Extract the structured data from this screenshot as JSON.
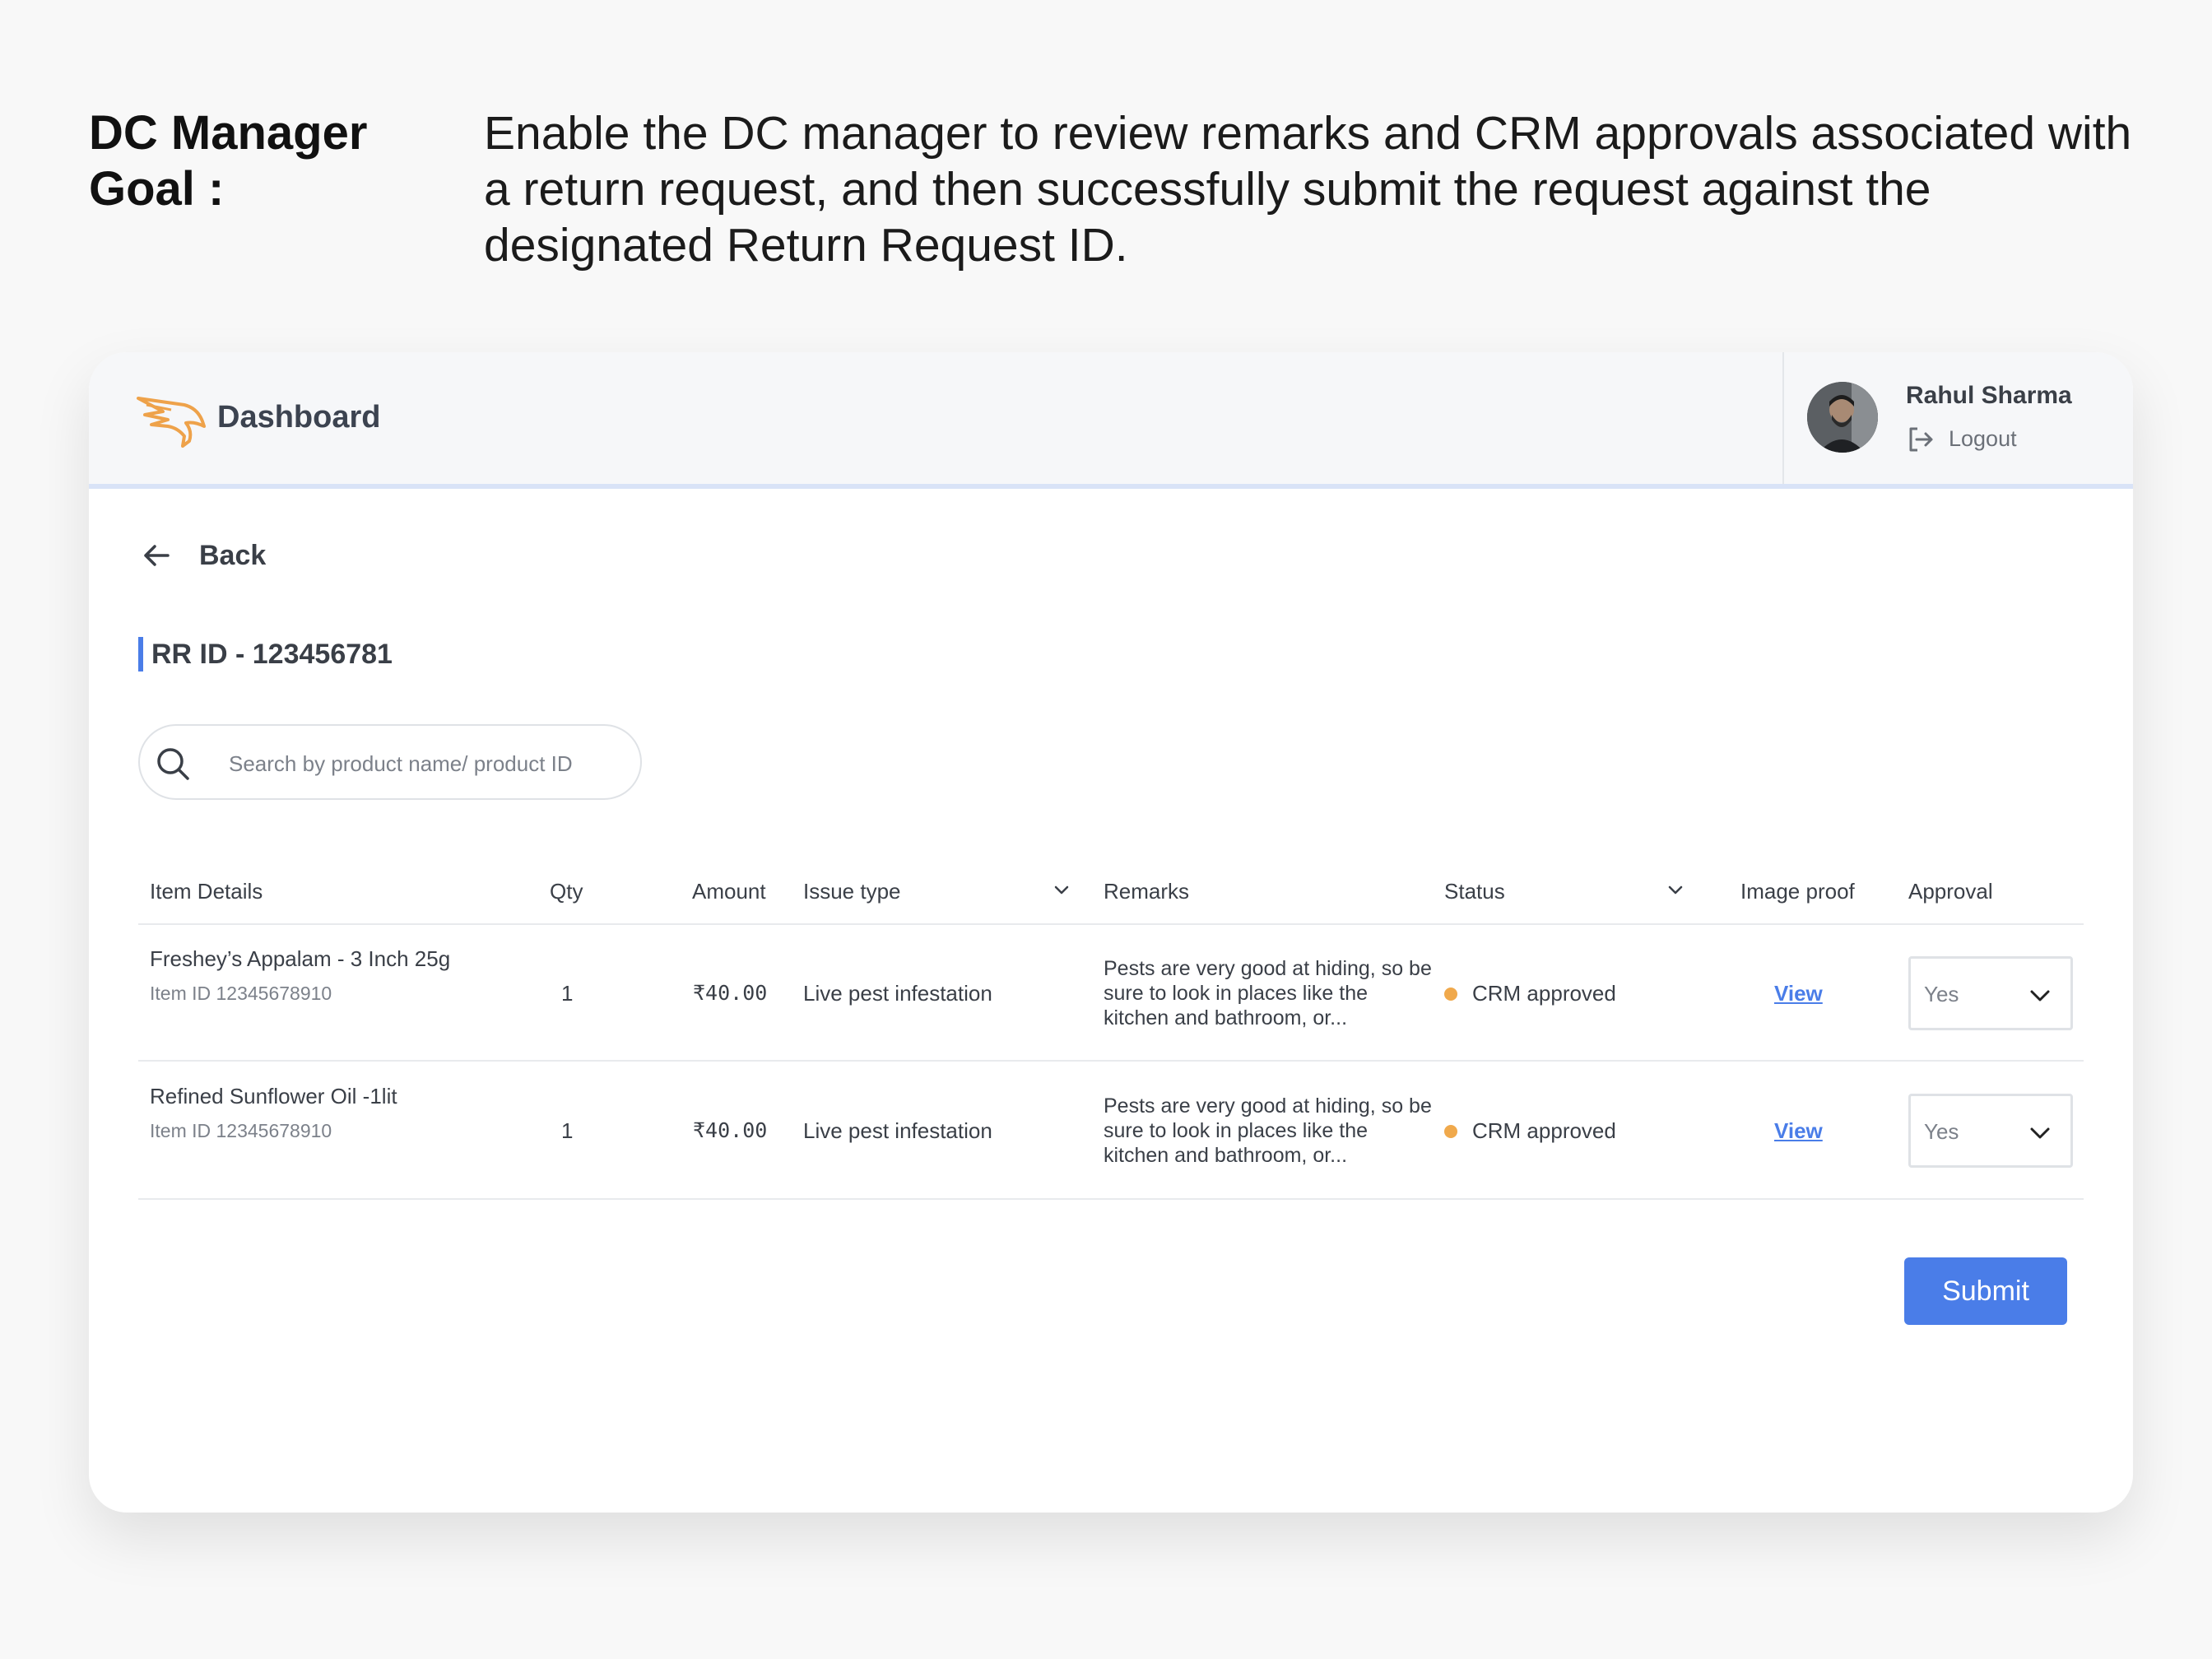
{
  "goal": {
    "label": "DC Manager Goal :",
    "text": " Enable the DC manager to review remarks and CRM approvals associated with a return request, and then successfully submit the request against the designated Return Request ID."
  },
  "header": {
    "brand": "Dashboard",
    "user_name": "Rahul Sharma",
    "logout_label": "Logout"
  },
  "page": {
    "back_label": "Back",
    "rr_id": "RR ID - 123456781"
  },
  "search": {
    "placeholder": "Search by product name/ product ID"
  },
  "table": {
    "columns": {
      "item_details": "Item Details",
      "qty": "Qty",
      "amount": "Amount",
      "issue_type": "Issue type",
      "remarks": "Remarks",
      "status": "Status",
      "image_proof": "Image proof",
      "approval": "Approval"
    },
    "rows": [
      {
        "item_name": "Freshey’s Appalam - 3 Inch 25g",
        "item_id": "Item ID 12345678910",
        "qty": "1",
        "amount": "₹40.00",
        "issue_type": "Live pest infestation",
        "remarks": "Pests are very good at hiding, so be sure to look in places like the kitchen and bathroom, or...",
        "status": "CRM approved",
        "image_proof": "View",
        "approval": "Yes"
      },
      {
        "item_name": "Refined Sunflower Oil -1lit",
        "item_id": "Item ID 12345678910",
        "qty": "1",
        "amount": "₹40.00",
        "issue_type": "Live pest infestation",
        "remarks": "Pests are very good at hiding, so be sure to look in places like the kitchen and bathroom, or...",
        "status": "CRM approved",
        "image_proof": "View",
        "approval": "Yes"
      }
    ]
  },
  "actions": {
    "submit_label": "Submit"
  },
  "colors": {
    "accent": "#4a7de8",
    "status_dot": "#f0a94c",
    "logo": "#eea24a"
  },
  "icons": {
    "logo": "eagle-logo-icon",
    "logout": "logout-icon",
    "back": "arrow-left-icon",
    "search": "search-icon",
    "dropdown": "chevron-down-icon"
  }
}
